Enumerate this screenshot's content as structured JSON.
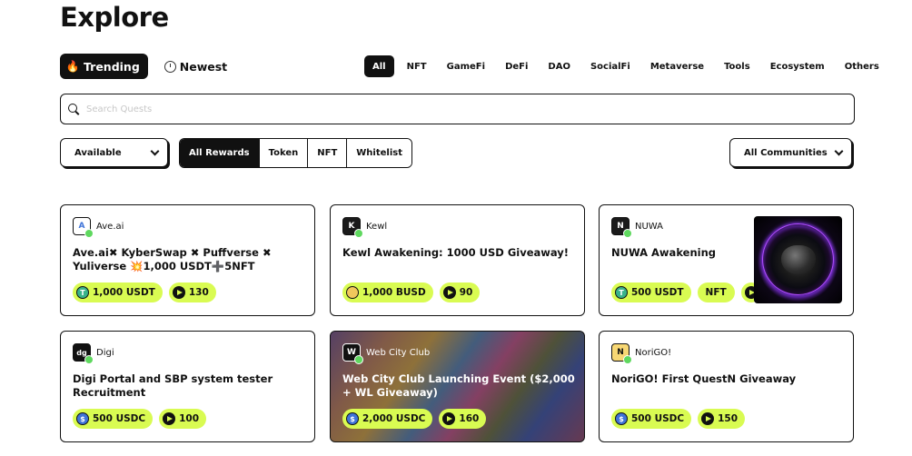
{
  "page": {
    "title": "Explore"
  },
  "sort": {
    "trending": "Trending",
    "newest": "Newest"
  },
  "categories": [
    "All",
    "NFT",
    "GameFi",
    "DeFi",
    "DAO",
    "SocialFi",
    "Metaverse",
    "Tools",
    "Ecosystem",
    "Others"
  ],
  "search": {
    "placeholder": "Search Quests",
    "value": ""
  },
  "filters": {
    "status": "Available",
    "rewards": [
      "All Rewards",
      "Token",
      "NFT",
      "Whitelist"
    ],
    "community": "All Communities"
  },
  "cards": [
    {
      "community": "Ave.ai",
      "logo_text": "A",
      "title": "Ave.ai✖ KyberSwap ✖ Puffverse ✖ Yuliverse 💥1,000 USDT➕5NFT",
      "reward": "1,000 USDT",
      "coin": "usdt",
      "xp": "130"
    },
    {
      "community": "Kewl",
      "logo_text": "K",
      "title": "Kewl Awakening: 1000 USD Giveaway!",
      "reward": "1,000 BUSD",
      "coin": "busd",
      "xp": "90"
    },
    {
      "community": "NUWA",
      "logo_text": "N",
      "title": "NUWA Awakening",
      "reward": "500 USDT",
      "coin": "usdt",
      "extra": "NFT"
    },
    {
      "community": "Digi",
      "logo_text": "dg",
      "title": "Digi Portal and SBP system tester Recruitment",
      "reward": "500 USDC",
      "coin": "usdc",
      "xp": "100"
    },
    {
      "community": "Web City Club",
      "logo_text": "W",
      "title": "Web City Club Launching Event ($2,000 + WL Giveaway)",
      "reward": "2,000 USDC",
      "coin": "usdc",
      "xp": "160"
    },
    {
      "community": "NoriGO!",
      "logo_text": "N",
      "title": "NoriGO! First QuestN Giveaway",
      "reward": "500 USDC",
      "coin": "usdc",
      "xp": "150"
    }
  ],
  "colors": {
    "accent": "#d9fb52",
    "dark": "#111111",
    "verified": "#5fd85f"
  },
  "icons": {
    "trending": "fire-icon",
    "newest": "clock-icon",
    "search": "search-icon",
    "xp": "play-icon"
  }
}
